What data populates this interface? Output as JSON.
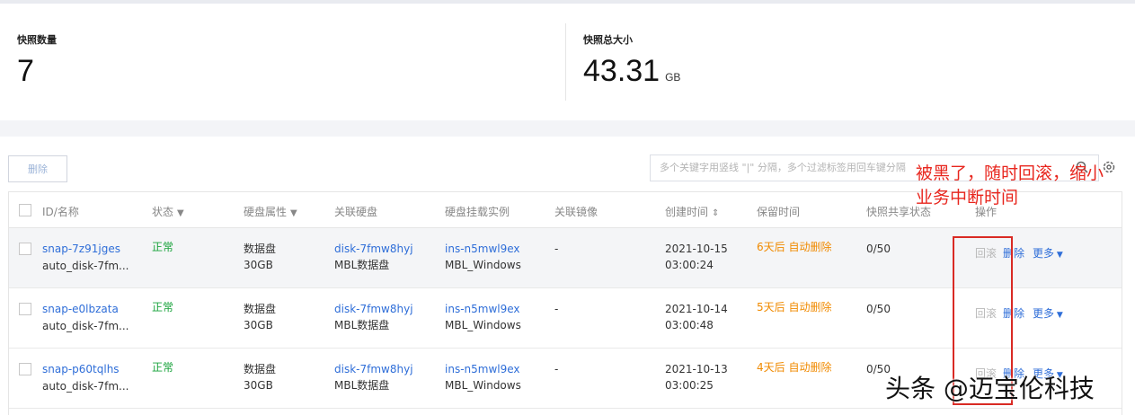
{
  "stats": {
    "count_label": "快照数量",
    "count_value": "7",
    "size_label": "快照总大小",
    "size_value": "43.31",
    "size_unit": "GB"
  },
  "toolbar": {
    "delete_label": "删除",
    "search_placeholder": "多个关键字用竖线 \"|\" 分隔，多个过滤标签用回车键分隔"
  },
  "table": {
    "headers": {
      "id_name": "ID/名称",
      "status": "状态",
      "disk_attr": "硬盘属性",
      "disk": "关联硬盘",
      "instance": "硬盘挂载实例",
      "image": "关联镜像",
      "created": "创建时间",
      "retention": "保留时间",
      "share": "快照共享状态",
      "ops": "操作"
    },
    "rows": [
      {
        "id": "snap-7z91jges",
        "name": "auto_disk-7fm...",
        "status": "正常",
        "disk_type": "数据盘",
        "disk_size": "30GB",
        "disk_id": "disk-7fmw8hyj",
        "disk_name": "MBL数据盘",
        "ins_id": "ins-n5mwl9ex",
        "ins_name": "MBL_Windows",
        "image": "-",
        "date": "2021-10-15",
        "time": "03:00:24",
        "retention": "6天后 自动删除",
        "share": "0/50",
        "rollback": "回滚",
        "delete": "删除",
        "more": "更多"
      },
      {
        "id": "snap-e0lbzata",
        "name": "auto_disk-7fm...",
        "status": "正常",
        "disk_type": "数据盘",
        "disk_size": "30GB",
        "disk_id": "disk-7fmw8hyj",
        "disk_name": "MBL数据盘",
        "ins_id": "ins-n5mwl9ex",
        "ins_name": "MBL_Windows",
        "image": "-",
        "date": "2021-10-14",
        "time": "03:00:48",
        "retention": "5天后 自动删除",
        "share": "0/50",
        "rollback": "回滚",
        "delete": "删除",
        "more": "更多"
      },
      {
        "id": "snap-p60tqlhs",
        "name": "auto_disk-7fm...",
        "status": "正常",
        "disk_type": "数据盘",
        "disk_size": "30GB",
        "disk_id": "disk-7fmw8hyj",
        "disk_name": "MBL数据盘",
        "ins_id": "ins-n5mwl9ex",
        "ins_name": "MBL_Windows",
        "image": "-",
        "date": "2021-10-13",
        "time": "03:00:25",
        "retention": "4天后 自动删除",
        "share": "0/50",
        "rollback": "回滚",
        "delete": "删除",
        "more": "更多"
      }
    ]
  },
  "annotation": {
    "line1": "被黑了，随时回滚，缩小",
    "line2": "业务中断时间"
  },
  "watermark": "头条 @迈宝伦科技",
  "colors": {
    "link": "#2f6ed8",
    "ok": "#1aa33c",
    "warn": "#f08a00",
    "annotation": "#e8261e"
  },
  "icons": [
    "filter-icon",
    "sort-icon",
    "search-icon",
    "gear-icon",
    "caret-down-icon"
  ]
}
